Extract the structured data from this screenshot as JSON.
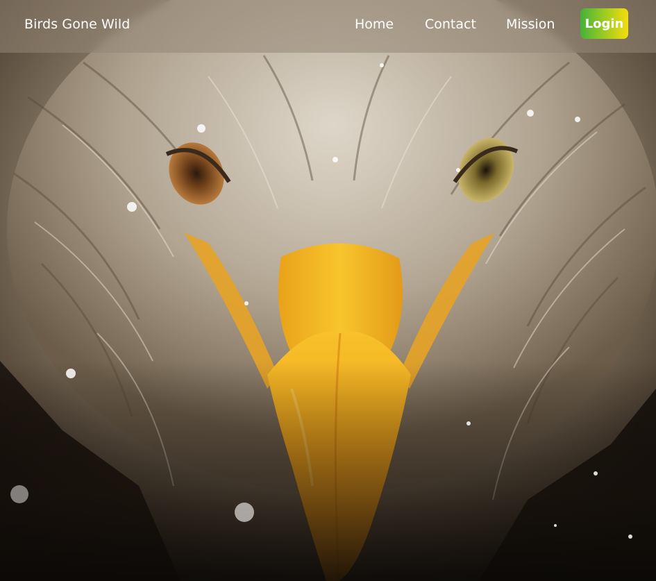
{
  "navbar": {
    "brand": "Birds Gone Wild",
    "links": [
      {
        "label": "Home"
      },
      {
        "label": "Contact"
      },
      {
        "label": "Mission"
      }
    ],
    "login_label": "Login"
  },
  "hero": {
    "image_icon": "eagle-photo",
    "colors": {
      "beak": "#f2a21c",
      "feathers": "#a89c8a",
      "login_gradient_start": "#45b13a",
      "login_gradient_end": "#f4dd0c"
    }
  }
}
